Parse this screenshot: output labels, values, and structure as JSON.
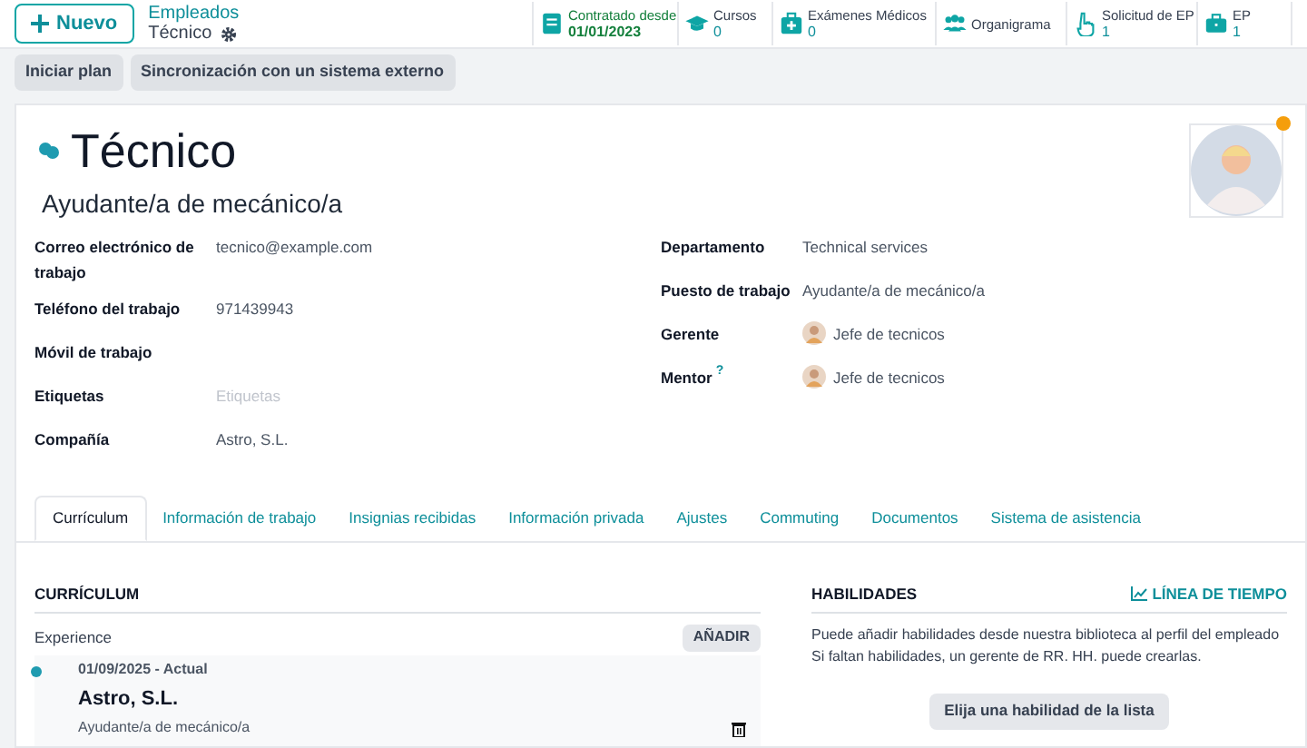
{
  "control_panel": {
    "new_button": "Nuevo",
    "breadcrumb": "Empleados",
    "record": "Técnico"
  },
  "smart_buttons": [
    {
      "kind": "contract",
      "label": "Contratado desde",
      "value": "01/01/2023"
    },
    {
      "kind": "courses",
      "label": "Cursos",
      "value": "0"
    },
    {
      "kind": "medical",
      "label": "Exámenes Médicos",
      "value": "0"
    },
    {
      "kind": "org",
      "label": "Organigrama"
    },
    {
      "kind": "request",
      "label": "Solicitud de EP",
      "value": "1"
    },
    {
      "kind": "ep",
      "label": "EP",
      "value": "1"
    }
  ],
  "action_buttons": [
    "Iniciar plan",
    "Sincronización con un sistema externo"
  ],
  "employee": {
    "name": "Técnico",
    "job_title": "Ayudante/a de mecánico/a"
  },
  "left_fields": [
    {
      "label": "Correo electrónico de trabajo",
      "value": "tecnico@example.com"
    },
    {
      "label": "Teléfono del trabajo",
      "value": "971439943"
    },
    {
      "label": "Móvil de trabajo"
    },
    {
      "label": "Etiquetas",
      "placeholder": "Etiquetas"
    },
    {
      "label": "Compañía",
      "value": "Astro, S.L."
    }
  ],
  "right_fields": [
    {
      "label": "Departamento",
      "value": "Technical services"
    },
    {
      "label": "Puesto de trabajo",
      "value": "Ayudante/a de mecánico/a"
    },
    {
      "label": "Gerente",
      "value": "Jefe de tecnicos",
      "avatar": true
    },
    {
      "label": "Mentor",
      "help": "?",
      "value": "Jefe de tecnicos",
      "avatar": true
    }
  ],
  "tabs": [
    {
      "label": "Currículum",
      "selected": true
    },
    {
      "label": "Información de trabajo",
      "selected": false
    },
    {
      "label": "Insignias recibidas",
      "selected": false
    },
    {
      "label": "Información privada",
      "selected": false
    },
    {
      "label": "Ajustes",
      "selected": false
    },
    {
      "label": "Commuting",
      "selected": false
    },
    {
      "label": "Documentos",
      "selected": false
    },
    {
      "label": "Sistema de asistencia",
      "selected": false
    }
  ],
  "resume": {
    "title": "CURRÍCULUM",
    "group": "Experience",
    "add_button": "AÑADIR",
    "lines": [
      {
        "dates": "01/09/2025 - Actual",
        "company": "Astro, S.L.",
        "description": "Ayudante/a de mecánico/a"
      }
    ]
  },
  "skills": {
    "title": "HABILIDADES",
    "timeline_link": "LÍNEA DE TIEMPO",
    "help": [
      "Puede añadir habilidades desde nuestra biblioteca al perfil del empleado",
      "Si faltan habilidades, un gerente de RR. HH. puede crearlas."
    ],
    "pick_button": "Elija una habilidad de la lista"
  }
}
